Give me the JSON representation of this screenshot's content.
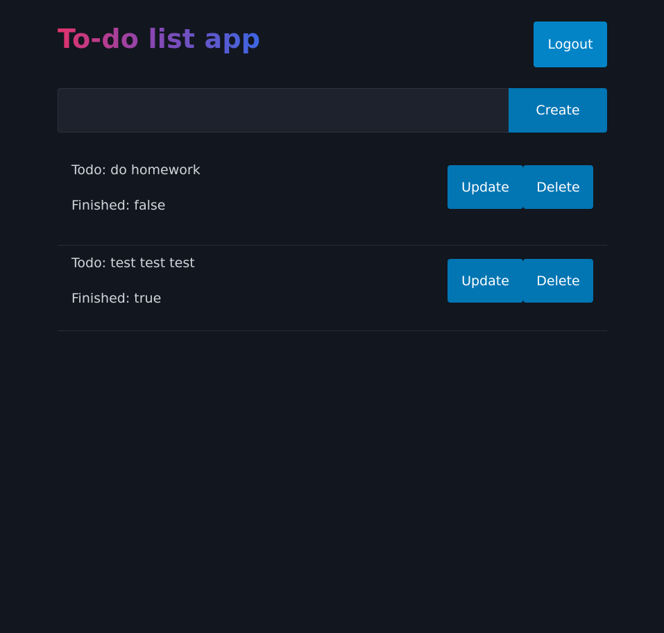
{
  "app": {
    "title": "To-do list app"
  },
  "header": {
    "logout_label": "Logout"
  },
  "create": {
    "input_value": "",
    "button_label": "Create"
  },
  "todos": [
    {
      "todo": "Todo: do homework",
      "finished": "Finished: false",
      "update_label": "Update",
      "delete_label": "Delete"
    },
    {
      "todo": "Todo: test test test",
      "finished": "Finished: true",
      "update_label": "Update",
      "delete_label": "Delete"
    }
  ],
  "colors": {
    "background": "#12161f",
    "button": "#0275b3",
    "title_gradient_start": "#e0336c",
    "title_gradient_end": "#3c66e2"
  }
}
